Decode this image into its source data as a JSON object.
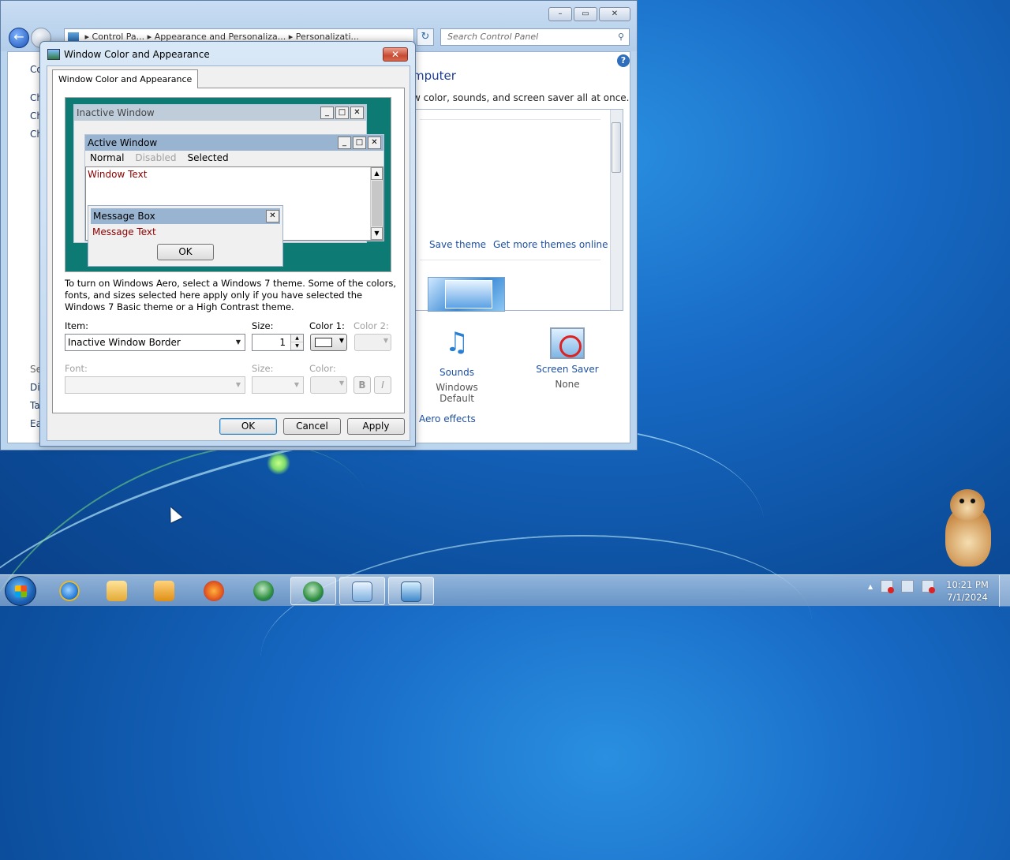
{
  "control_panel": {
    "caption_buttons": [
      "–",
      "▭",
      "✕"
    ],
    "address": [
      "Control Pa...",
      "Appearance and Personaliza...",
      "Personalizati..."
    ],
    "search_placeholder": "Search Control Panel",
    "sidebar_fragments": [
      "Co",
      "Ch",
      "Ch",
      "Ch",
      "Se",
      "Dis",
      "Ta",
      "Ea"
    ],
    "heading": "mputer",
    "subtitle": "w color, sounds, and screen saver all at once.",
    "save_theme": "Save theme",
    "get_more_themes": "Get more themes online",
    "sounds": {
      "label": "Sounds",
      "value": "Windows Default"
    },
    "screen_saver": {
      "label": "Screen Saver",
      "value": "None"
    },
    "aero_link": "Aero effects",
    "help": "?"
  },
  "dialog": {
    "title": "Window Color and Appearance",
    "tab": "Window Color and Appearance",
    "preview": {
      "inactive_title": "Inactive Window",
      "active_title": "Active Window",
      "menu_normal": "Normal",
      "menu_disabled": "Disabled",
      "menu_selected": "Selected",
      "window_text": "Window Text",
      "message_box_title": "Message Box",
      "message_text": "Message Text",
      "ok": "OK"
    },
    "info_text": "To turn on Windows Aero, select a Windows 7 theme.  Some of the colors, fonts, and sizes selected here apply only if you have selected the Windows 7 Basic theme or a High Contrast theme.",
    "item_label": "Item:",
    "item_value": "Inactive Window Border",
    "size_label": "Size:",
    "size_value": "1",
    "color1_label": "Color 1:",
    "color2_label": "Color 2:",
    "font_label": "Font:",
    "font_size_label": "Size:",
    "font_color_label": "Color:",
    "bold": "B",
    "italic": "I",
    "ok": "OK",
    "cancel": "Cancel",
    "apply": "Apply",
    "colors": {
      "preview_bg": "#0d7a74",
      "inactive_title_bg": "#bfcddb",
      "active_title_bg": "#99b4d1",
      "window_text_color": "#8b0000"
    }
  },
  "taskbar": {
    "time": "10:21 PM",
    "date": "7/1/2024",
    "tray_arrow": "▲"
  }
}
